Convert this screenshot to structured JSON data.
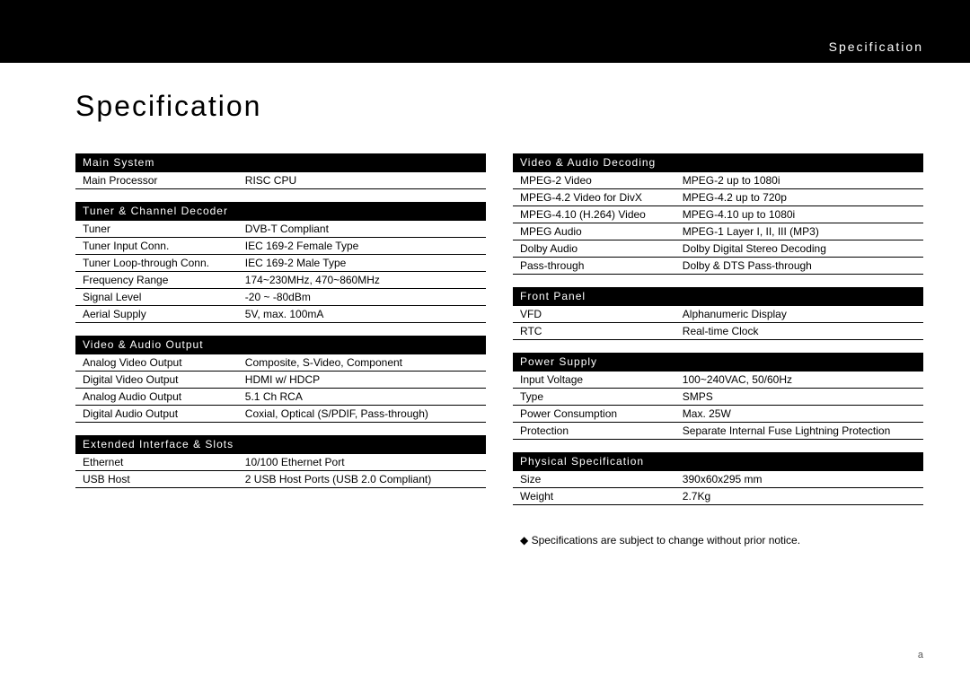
{
  "header": {
    "breadcrumb": "Specification"
  },
  "title": "Specification",
  "columns": [
    [
      {
        "header": "Main System",
        "rows": [
          {
            "k": "Main Processor",
            "v": "RISC CPU"
          }
        ]
      },
      {
        "header": "Tuner & Channel Decoder",
        "rows": [
          {
            "k": "Tuner",
            "v": "DVB-T Compliant"
          },
          {
            "k": "Tuner Input Conn.",
            "v": "IEC 169-2 Female Type"
          },
          {
            "k": "Tuner Loop-through Conn.",
            "v": "IEC 169-2 Male Type"
          },
          {
            "k": "Frequency Range",
            "v": "174~230MHz, 470~860MHz"
          },
          {
            "k": "Signal Level",
            "v": "-20 ~ -80dBm"
          },
          {
            "k": "Aerial Supply",
            "v": "5V, max. 100mA"
          }
        ]
      },
      {
        "header": "Video & Audio Output",
        "rows": [
          {
            "k": "Analog Video Output",
            "v": "Composite, S-Video, Component"
          },
          {
            "k": "Digital Video Output",
            "v": "HDMI w/ HDCP"
          },
          {
            "k": "Analog Audio Output",
            "v": "5.1 Ch RCA"
          },
          {
            "k": "Digital Audio Output",
            "v": "Coxial, Optical (S/PDIF, Pass-through)"
          }
        ]
      },
      {
        "header": "Extended Interface & Slots",
        "rows": [
          {
            "k": "Ethernet",
            "v": "10/100 Ethernet Port"
          },
          {
            "k": "USB Host",
            "v": "2 USB Host Ports (USB 2.0 Compliant)"
          }
        ]
      }
    ],
    [
      {
        "header": "Video & Audio Decoding",
        "rows": [
          {
            "k": "MPEG-2 Video",
            "v": "MPEG-2 up to 1080i"
          },
          {
            "k": "MPEG-4.2 Video for DivX",
            "v": "MPEG-4.2 up to 720p"
          },
          {
            "k": "MPEG-4.10 (H.264) Video",
            "v": "MPEG-4.10 up to 1080i"
          },
          {
            "k": "MPEG Audio",
            "v": "MPEG-1 Layer I, II, III (MP3)"
          },
          {
            "k": "Dolby Audio",
            "v": "Dolby Digital Stereo Decoding"
          },
          {
            "k": "Pass-through",
            "v": "Dolby & DTS Pass-through"
          }
        ]
      },
      {
        "header": "Front Panel",
        "rows": [
          {
            "k": "VFD",
            "v": "Alphanumeric Display"
          },
          {
            "k": "RTC",
            "v": "Real-time Clock"
          }
        ]
      },
      {
        "header": "Power Supply",
        "rows": [
          {
            "k": "Input Voltage",
            "v": "100~240VAC, 50/60Hz"
          },
          {
            "k": "Type",
            "v": "SMPS"
          },
          {
            "k": "Power Consumption",
            "v": "Max. 25W"
          },
          {
            "k": "Protection",
            "v": "Separate Internal Fuse Lightning Protection"
          }
        ]
      },
      {
        "header": "Physical Specification",
        "rows": [
          {
            "k": "Size",
            "v": "390x60x295 mm"
          },
          {
            "k": "Weight",
            "v": "2.7Kg"
          }
        ]
      }
    ]
  ],
  "footnote": "◆ Specifications are subject to change without prior notice.",
  "pagenum": "a"
}
